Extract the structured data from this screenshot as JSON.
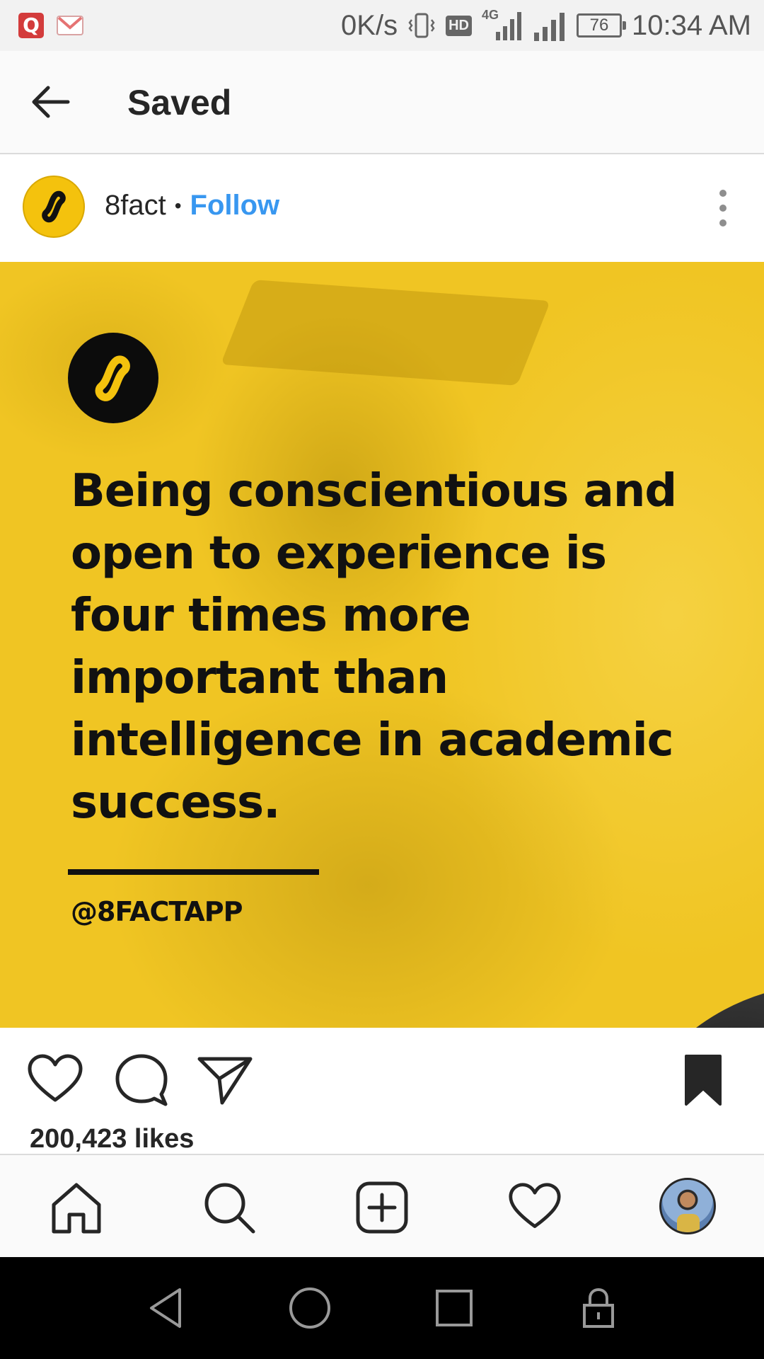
{
  "status_bar": {
    "speed": "0K/s",
    "hd_label": "HD",
    "network_label": "4G",
    "battery": "76",
    "time": "10:34 AM"
  },
  "header": {
    "title": "Saved",
    "back_icon": "arrow-left-icon"
  },
  "post": {
    "username": "8fact",
    "separator": "•",
    "follow_label": "Follow",
    "image": {
      "fact_text": "Being conscientious and open to experience is four times more important than intelligence in academic success.",
      "handle": "@8FACTAPP",
      "brand_color": "#f4c20d"
    },
    "likes": "200,423 likes",
    "actions": [
      "heart-icon",
      "comment-icon",
      "share-icon",
      "bookmark-icon"
    ]
  },
  "bottom_nav": {
    "items": [
      "home-icon",
      "search-icon",
      "add-post-icon",
      "activity-heart-icon",
      "profile-avatar"
    ]
  },
  "system_nav": {
    "items": [
      "back-triangle-icon",
      "home-circle-icon",
      "recents-square-icon",
      "lock-icon"
    ]
  },
  "colors": {
    "link": "#3897f0",
    "text": "#262626",
    "post_background": "#f0c523"
  }
}
